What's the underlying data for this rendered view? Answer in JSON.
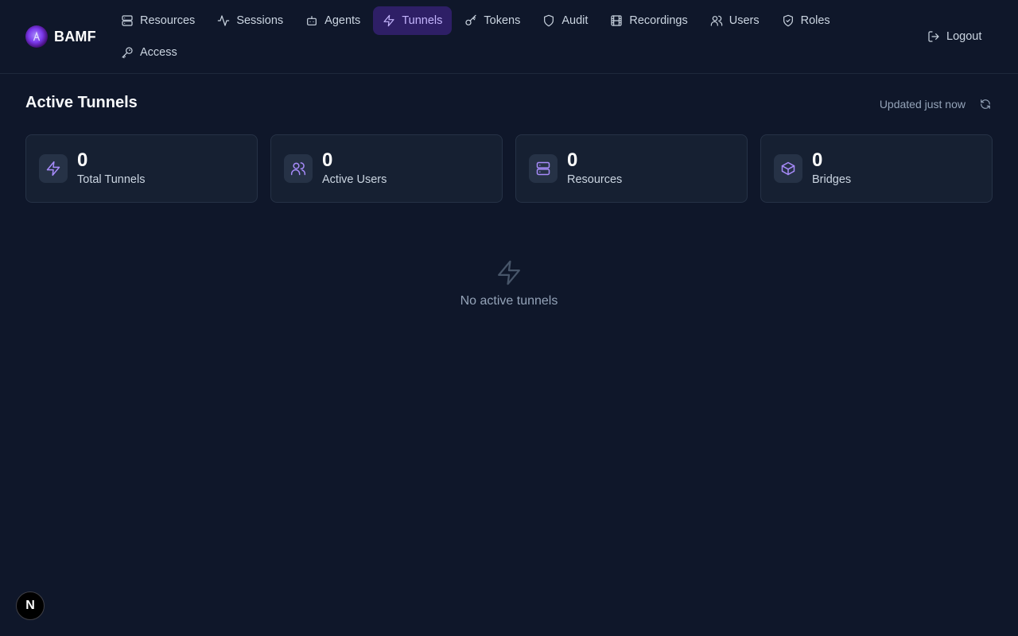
{
  "brand": {
    "name": "BAMF"
  },
  "nav": {
    "row1": [
      {
        "label": "Resources",
        "icon": "server-icon"
      },
      {
        "label": "Sessions",
        "icon": "activity-icon"
      },
      {
        "label": "Agents",
        "icon": "bot-icon"
      },
      {
        "label": "Tunnels",
        "icon": "zap-icon",
        "active": true
      },
      {
        "label": "Tokens",
        "icon": "key-icon"
      },
      {
        "label": "Audit",
        "icon": "shield-icon"
      },
      {
        "label": "Recordings",
        "icon": "film-icon"
      },
      {
        "label": "Users",
        "icon": "users-icon"
      },
      {
        "label": "Roles",
        "icon": "shield-check-icon"
      }
    ],
    "row2": [
      {
        "label": "Access",
        "icon": "key-round-icon"
      }
    ]
  },
  "logout": {
    "label": "Logout"
  },
  "page": {
    "title": "Active Tunnels",
    "updated": "Updated just now"
  },
  "stats": [
    {
      "value": "0",
      "label": "Total Tunnels",
      "icon": "zap-icon"
    },
    {
      "value": "0",
      "label": "Active Users",
      "icon": "users-icon"
    },
    {
      "value": "0",
      "label": "Resources",
      "icon": "server-icon"
    },
    {
      "value": "0",
      "label": "Bridges",
      "icon": "box-icon"
    }
  ],
  "empty": {
    "text": "No active tunnels"
  },
  "dev_badge": {
    "label": "N"
  },
  "colors": {
    "background": "#0f172a",
    "card": "#162032",
    "accent": "#a78bfa",
    "active_nav_bg": "#2e1f66"
  }
}
